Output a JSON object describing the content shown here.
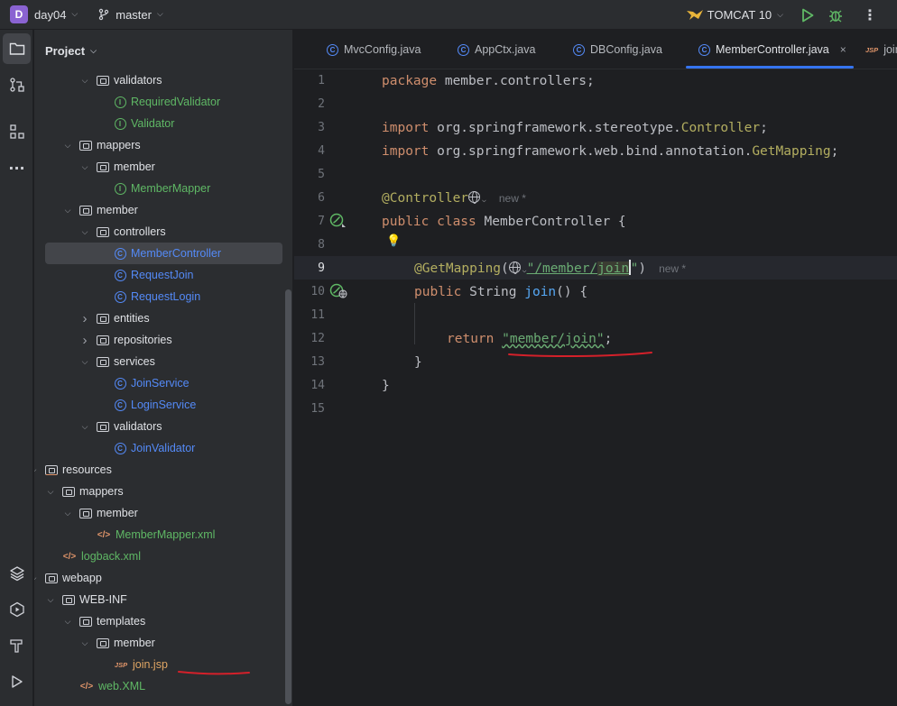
{
  "titlebar": {
    "project_initial": "D",
    "project_name": "day04",
    "branch_name": "master",
    "run_config": "TOMCAT 10"
  },
  "project_panel": {
    "title": "Project",
    "tree": [
      {
        "label": "validators",
        "kind": "folder",
        "depth": 5,
        "expanded": true
      },
      {
        "label": "RequiredValidator",
        "kind": "interface",
        "depth": 6
      },
      {
        "label": "Validator",
        "kind": "interface",
        "depth": 6
      },
      {
        "label": "mappers",
        "kind": "folder",
        "depth": 4,
        "expanded": true
      },
      {
        "label": "member",
        "kind": "folder",
        "depth": 5,
        "expanded": true
      },
      {
        "label": "MemberMapper",
        "kind": "interface",
        "depth": 6
      },
      {
        "label": "member",
        "kind": "folder",
        "depth": 4,
        "expanded": true
      },
      {
        "label": "controllers",
        "kind": "folder",
        "depth": 5,
        "expanded": true
      },
      {
        "label": "MemberController",
        "kind": "class",
        "depth": 6,
        "selected": true
      },
      {
        "label": "RequestJoin",
        "kind": "class",
        "depth": 6
      },
      {
        "label": "RequestLogin",
        "kind": "class",
        "depth": 6
      },
      {
        "label": "entities",
        "kind": "folder",
        "depth": 5,
        "expanded": false
      },
      {
        "label": "repositories",
        "kind": "folder",
        "depth": 5,
        "expanded": false
      },
      {
        "label": "services",
        "kind": "folder",
        "depth": 5,
        "expanded": true
      },
      {
        "label": "JoinService",
        "kind": "class",
        "depth": 6
      },
      {
        "label": "LoginService",
        "kind": "class",
        "depth": 6
      },
      {
        "label": "validators",
        "kind": "folder",
        "depth": 5,
        "expanded": true
      },
      {
        "label": "JoinValidator",
        "kind": "class",
        "depth": 6
      },
      {
        "label": "resources",
        "kind": "resfolder",
        "depth": 2,
        "expanded": true
      },
      {
        "label": "mappers",
        "kind": "folder",
        "depth": 3,
        "expanded": true
      },
      {
        "label": "member",
        "kind": "folder",
        "depth": 4,
        "expanded": true
      },
      {
        "label": "MemberMapper.xml",
        "kind": "xml",
        "depth": 5
      },
      {
        "label": "logback.xml",
        "kind": "xml",
        "depth": 3
      },
      {
        "label": "webapp",
        "kind": "folder",
        "depth": 2,
        "expanded": true
      },
      {
        "label": "WEB-INF",
        "kind": "folder",
        "depth": 3,
        "expanded": true
      },
      {
        "label": "templates",
        "kind": "folder",
        "depth": 4,
        "expanded": true
      },
      {
        "label": "member",
        "kind": "folder",
        "depth": 5,
        "expanded": true
      },
      {
        "label": "join.jsp",
        "kind": "jsp",
        "depth": 6
      },
      {
        "label": "web.XML",
        "kind": "xml",
        "depth": 4
      }
    ]
  },
  "tabs": [
    {
      "label": "MvcConfig.java"
    },
    {
      "label": "AppCtx.java"
    },
    {
      "label": "DBConfig.java"
    },
    {
      "label": "MemberController.java",
      "active": true
    },
    {
      "label": "join",
      "kind": "jsp"
    }
  ],
  "tab_close_glyph": "×",
  "gutter": [
    "1",
    "2",
    "3",
    "4",
    "5",
    "6",
    "7",
    "8",
    "9",
    "10",
    "11",
    "12",
    "13",
    "14",
    "15"
  ],
  "code": {
    "l1_kw": "package",
    "l1_rest": " member.controllers;",
    "l3_kw": "import",
    "l3_rest": " org.springframework.stereotype.",
    "l3_cls": "Controller",
    "l3_end": ";",
    "l4_kw": "import",
    "l4_rest": " org.springframework.web.bind.annotation.",
    "l4_cls": "GetMapping",
    "l4_end": ";",
    "l6_ann": "@Controller",
    "l6_hint": "new *",
    "l7_kw": "public class",
    "l7_rest": " MemberController {",
    "l9_ann": "@GetMapping",
    "l9_open": "(",
    "l9_str1": "\"/member/",
    "l9_str2": "join",
    "l9_str3": "\"",
    "l9_close": ")",
    "l9_hint": "new *",
    "l10_kw": "public",
    "l10_type": " String ",
    "l10_fn": "join",
    "l10_rest": "() {",
    "l12_kw": "return",
    "l12_str": "\"member/join\"",
    "l12_end": ";",
    "l13": "}",
    "l14": "}"
  },
  "lightbulb": "💡",
  "colors": {
    "accent": "#3574f0",
    "annotation_red": "#d4202a"
  }
}
